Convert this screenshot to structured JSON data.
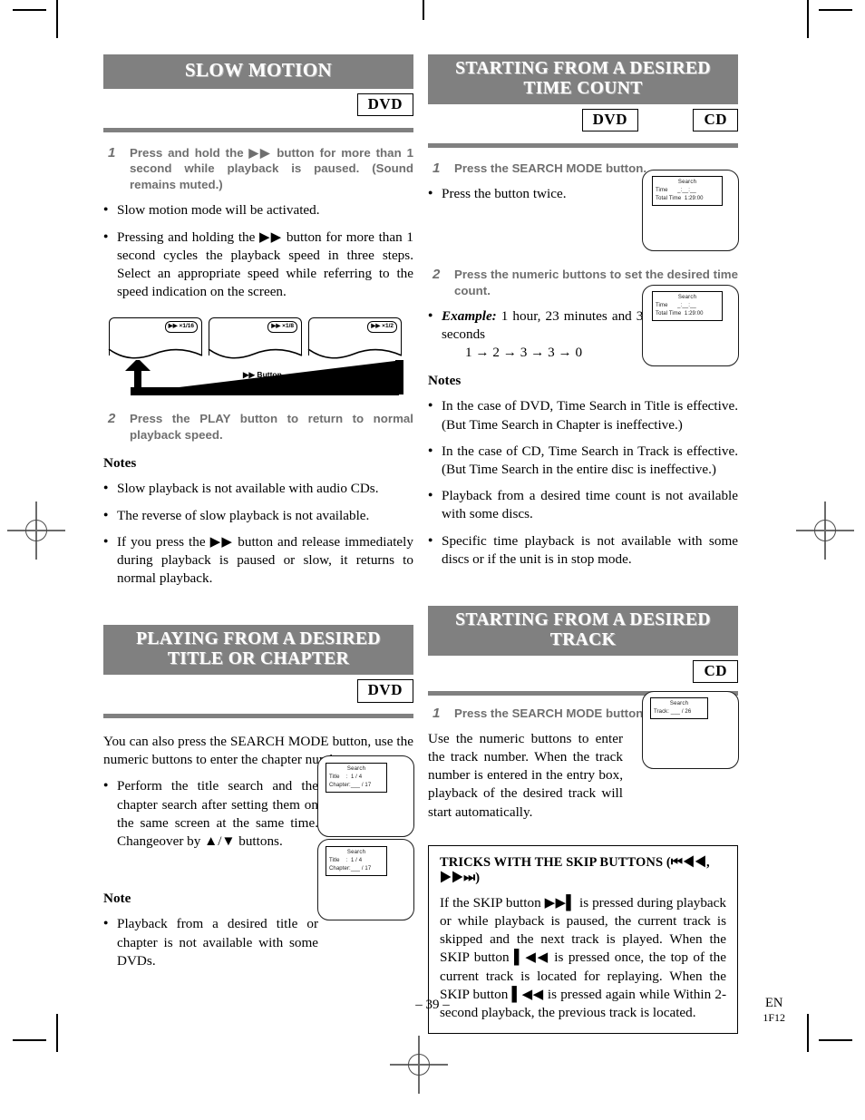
{
  "document": {
    "page_number": "– 39 –",
    "imprint_lang": "EN",
    "imprint_code": "1F12"
  },
  "colors": {
    "header_bar": "#808080",
    "header_text": "#ffffff",
    "step_text": "#6f6f6f",
    "rule": "#808080"
  },
  "left_column": {
    "section1": {
      "title": "SLOW MOTION",
      "disc_tags": [
        "DVD"
      ],
      "steps": [
        {
          "num": "1",
          "text": "Press and hold the ▶▶ button for more than 1 second while playback is paused. (Sound remains muted.)"
        },
        {
          "num": "2",
          "text": "Press the PLAY button to return to normal playback speed."
        }
      ],
      "bullets_after_step1": [
        "Slow motion mode will be activated.",
        "Pressing and holding the ▶▶ button for more than 1 second cycles the playback speed in three steps. Select an appropriate speed while referring to the speed indication on the screen."
      ],
      "figure": {
        "screens": [
          {
            "speed_label": "▶▶ ×1/16"
          },
          {
            "speed_label": "▶▶ ×1/8"
          },
          {
            "speed_label": "▶▶ ×1/2"
          }
        ],
        "cycle_label": "▶▶ Button"
      },
      "notes_heading": "Notes",
      "notes": [
        "Slow playback is not available with audio CDs.",
        "The reverse of slow playback is not available.",
        "If you press the ▶▶ button and release immediately during playback is paused or slow, it returns to normal playback."
      ]
    },
    "section2": {
      "title_line1": "PLAYING FROM A DESIRED",
      "title_line2": "TITLE OR CHAPTER",
      "disc_tags": [
        "DVD"
      ],
      "intro": "You can also press the SEARCH MODE button, use the numeric buttons to enter the chapter number.",
      "bullets": [
        "Perform the title search and the chapter search after setting them on the same screen at the same time. Changeover by ▲/▼ buttons."
      ],
      "note_heading": "Note",
      "notes": [
        "Playback from a desired title or chapter is not available with some DVDs."
      ],
      "osd_screens": [
        {
          "title": "Search",
          "rows": [
            "Title    :  1 / 4",
            "Chapter:___ / 17"
          ]
        },
        {
          "title": "Search",
          "rows": [
            "Title    :  1 / 4",
            "Chapter:___ / 17"
          ]
        }
      ]
    }
  },
  "right_column": {
    "section1": {
      "title_line1": "STARTING FROM A DESIRED",
      "title_line2": "TIME COUNT",
      "disc_tags": [
        "DVD",
        "CD"
      ],
      "steps": [
        {
          "num": "1",
          "text": "Press the SEARCH MODE button."
        },
        {
          "num": "2",
          "text": "Press the numeric buttons to set the desired time count."
        }
      ],
      "bullet_after_step1": "Press the button twice.",
      "example_label": "Example:",
      "example_text": " 1 hour, 23 minutes and 30 seconds",
      "example_sequence": "1 → 2 → 3 → 3 → 0",
      "osd_screens": [
        {
          "title": "Search",
          "rows": [
            "Time      _:__:__",
            "Total Time  1:29:00"
          ]
        },
        {
          "title": "Search",
          "rows": [
            "Time      _:__:__",
            "Total Time  1:29:00"
          ]
        }
      ],
      "notes_heading": "Notes",
      "notes": [
        "In the case of DVD, Time Search in Title is effective. (But Time Search in Chapter is ineffective.)",
        "In the case of CD, Time Search in Track is effective. (But Time Search in the entire disc is ineffective.)",
        "Playback from a desired time count is not available with some discs.",
        "Specific time playback is not available with some discs or if the unit is in stop mode."
      ]
    },
    "section2": {
      "title_line1": "STARTING FROM A DESIRED",
      "title_line2": "TRACK",
      "disc_tags": [
        "CD"
      ],
      "steps": [
        {
          "num": "1",
          "text": "Press the SEARCH MODE button."
        }
      ],
      "intro": "Use the numeric buttons to enter the track number. When the track number is entered in the entry box, playback of the desired track will start automatically.",
      "osd_screens": [
        {
          "title": "Search",
          "rows": [
            "Track: ___ / 26"
          ]
        }
      ],
      "tricks": {
        "heading": "TRICKS WITH THE SKIP BUTTONS (⏮◀◀, ▶▶⏭)",
        "body": "If the SKIP button ▶▶▌ is pressed during playback or while playback is paused, the current track is skipped and the next track is played. When the SKIP button ▌◀◀ is pressed once, the top of the current track is located for replaying. When the SKIP button ▌◀◀ is pressed again while Within 2-second playback, the previous track is located."
      }
    }
  }
}
